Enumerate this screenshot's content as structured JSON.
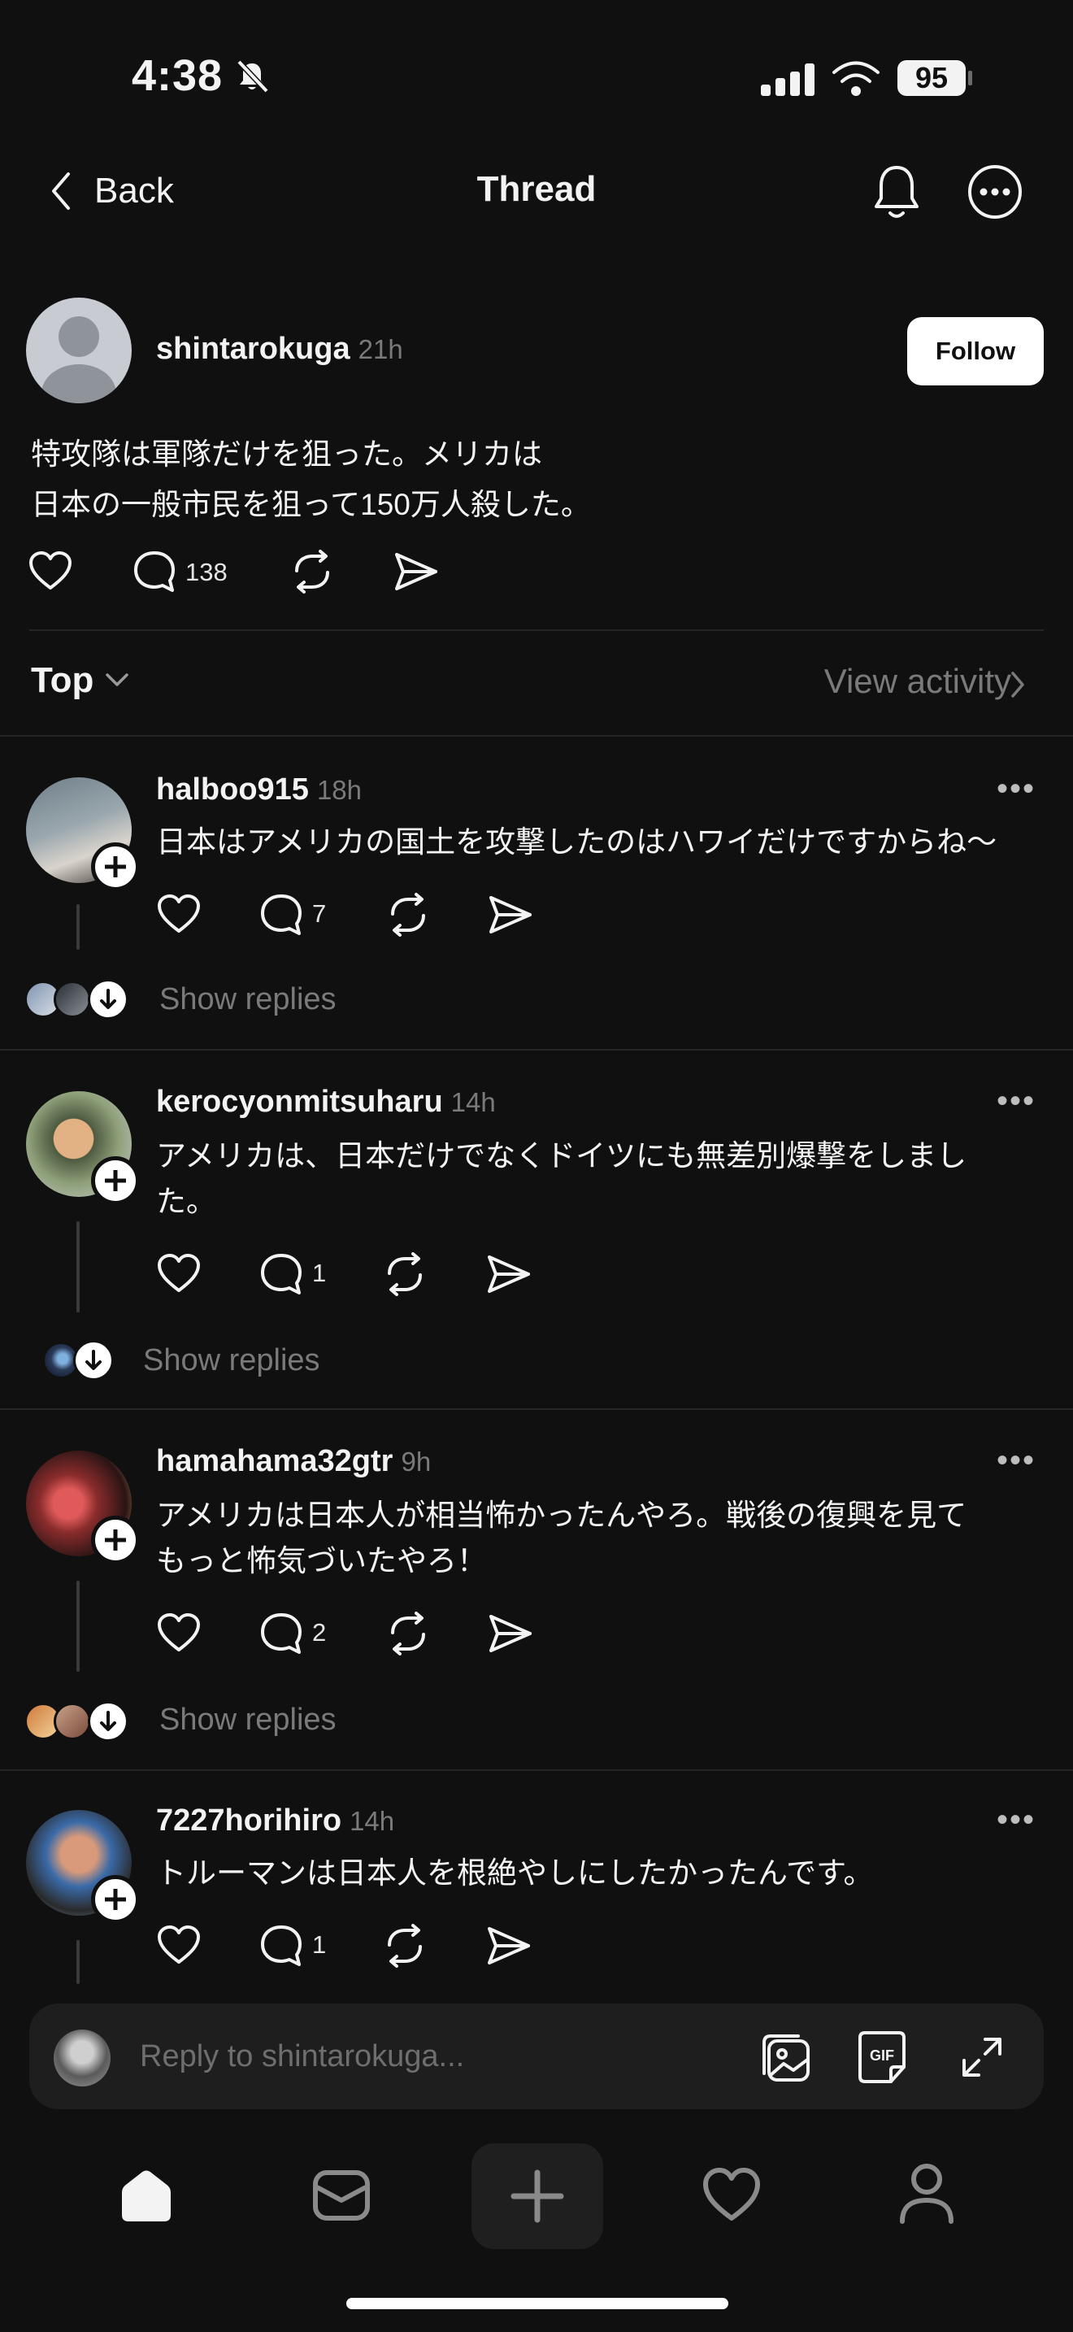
{
  "status_bar": {
    "time": "4:38",
    "battery": "95"
  },
  "header": {
    "back_label": "Back",
    "title": "Thread"
  },
  "post": {
    "username": "shintarokuga",
    "time": "21h",
    "follow_label": "Follow",
    "text": "特攻隊は軍隊だけを狙った。メリカは\n日本の一般市民を狙って150万人殺した。",
    "reply_count": "138"
  },
  "sort": {
    "label": "Top",
    "activity_label": "View activity"
  },
  "comments": [
    {
      "username": "halboo915",
      "time": "18h",
      "text": "日本はアメリカの国土を攻撃したのはハワイだけですからね〜",
      "reply_count": "7",
      "show_replies": "Show replies"
    },
    {
      "username": "kerocyonmitsuharu",
      "time": "14h",
      "text": "アメリカは、日本だけでなくドイツにも無差別爆撃をしまし\nた。",
      "reply_count": "1",
      "show_replies": "Show replies"
    },
    {
      "username": "hamahama32gtr",
      "time": "9h",
      "text": "アメリカは日本人が相当怖かったんやろ。戦後の復興を見て\nもっと怖気づいたやろ！",
      "reply_count": "2",
      "show_replies": "Show replies"
    },
    {
      "username": "7227horihiro",
      "time": "14h",
      "text": "トルーマンは日本人を根絶やしにしたかったんです。",
      "reply_count": "1"
    }
  ],
  "reply_box": {
    "placeholder": "Reply to shintarokuga..."
  },
  "icons": {
    "back": "chevron-left-icon",
    "bell": "bell-icon",
    "more": "more-circle-icon",
    "like": "heart-icon",
    "comment": "comment-bubble-icon",
    "repost": "repost-icon",
    "share": "send-icon",
    "media": "image-icon",
    "gif": "gif-icon",
    "expand": "expand-icon",
    "nav": [
      "home-icon",
      "inbox-icon",
      "plus-icon",
      "heart-icon",
      "profile-icon"
    ]
  },
  "colors": {
    "background": "#101010",
    "text": "#f3f3f3",
    "muted": "#7a7a7a",
    "follow_bg": "#ffffff"
  }
}
